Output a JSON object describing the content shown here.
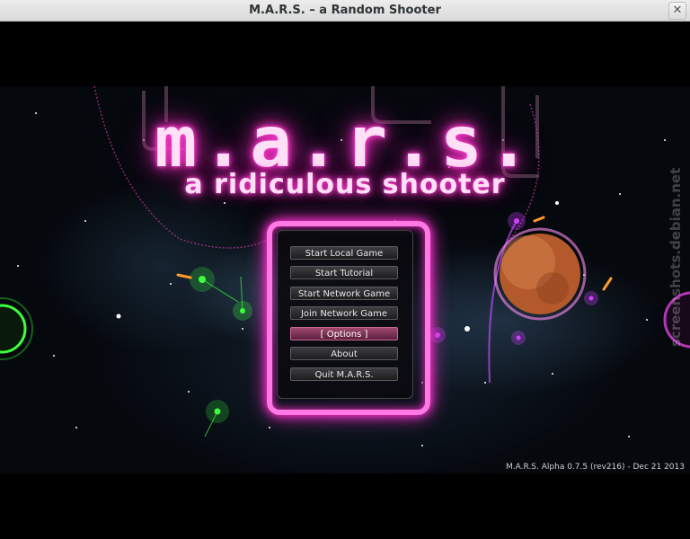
{
  "window": {
    "title": "M.A.R.S. – a Random Shooter",
    "close_icon": "close-icon"
  },
  "logo": {
    "main": "m.a.r.s.",
    "subtitle": "a ridiculous shooter"
  },
  "menu": {
    "items": [
      {
        "label": "Start Local Game"
      },
      {
        "label": "Start Tutorial"
      },
      {
        "label": "Start Network Game"
      },
      {
        "label": "Join Network Game"
      },
      {
        "label": "[ Options ]",
        "selected": true
      },
      {
        "label": "About"
      },
      {
        "label": "Quit M.A.R.S."
      }
    ]
  },
  "footer": {
    "version": "M.A.R.S. Alpha 0.7.5 (rev216) - Dec 21 2013",
    "watermark": "screenshots.debian.net"
  },
  "colors": {
    "neon_pink": "#ff3ccf",
    "neon_green": "#38ff3c",
    "planet_orange": "#c96a32",
    "selected_button": "#8a3a5e"
  }
}
